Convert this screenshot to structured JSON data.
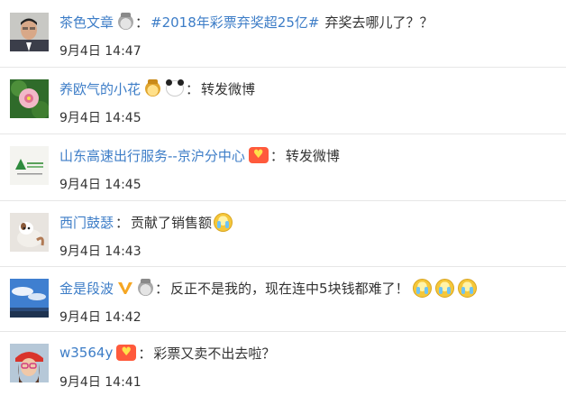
{
  "comments": [
    {
      "username": "茶色文章",
      "badges": [
        "silver-medal-icon"
      ],
      "topic": "#2018年彩票弃奖超25亿#",
      "text": "弃奖去哪儿了？？",
      "time": "9月4日 14:47",
      "avatar": "man-portrait-avatar"
    },
    {
      "username": "养欧气的小花",
      "badges": [
        "gold-medal-icon",
        "panda-icon"
      ],
      "text": "转发微博",
      "time": "9月4日 14:45",
      "avatar": "green-flower-avatar"
    },
    {
      "username": "山东高速出行服务--京沪分中心",
      "badges": [
        "heart-badge-icon"
      ],
      "text": "转发微博",
      "time": "9月4日 14:45",
      "avatar": "logo-avatar"
    },
    {
      "username": "西门鼓瑟",
      "badges": [],
      "text": "贡献了销售额",
      "emojis": [
        "crying-emoji-icon"
      ],
      "time": "9月4日 14:43",
      "avatar": "cat-avatar"
    },
    {
      "username": "金是段波",
      "badges": [
        "vip-v-icon",
        "silver-medal-icon"
      ],
      "text": "反正不是我的，现在连中5块钱都难了！",
      "emojis": [
        "crying-emoji-icon",
        "crying-emoji-icon",
        "crying-emoji-icon"
      ],
      "time": "9月4日 14:42",
      "avatar": "sky-landscape-avatar"
    },
    {
      "username": "w3564y",
      "badges": [
        "heart-badge-icon"
      ],
      "text": "彩票又卖不出去啦？",
      "time": "9月4日 14:41",
      "avatar": "girl-red-hat-avatar"
    }
  ],
  "colors": {
    "username": "#3d7dc7",
    "text": "#333333",
    "divider": "#e6e6e6"
  }
}
